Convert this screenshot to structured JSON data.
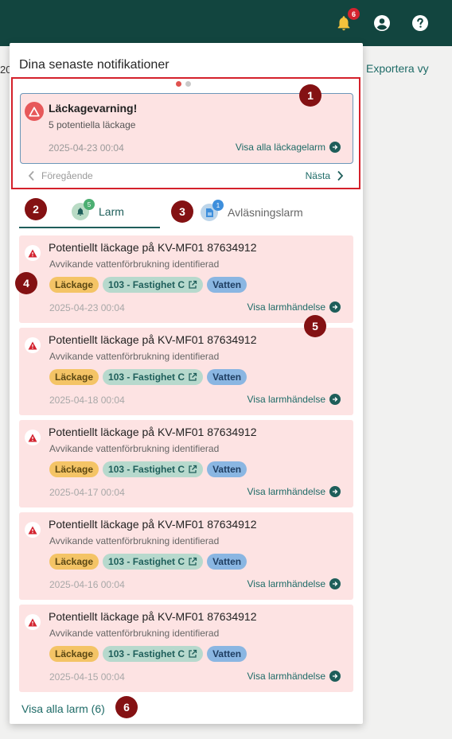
{
  "topbar": {
    "notification_count": "6",
    "bell_icon": "bell-icon",
    "user_icon": "user-circle-icon",
    "help_icon": "help-circle-icon",
    "bg_color": "#12453f"
  },
  "background": {
    "partial_number": "20",
    "export_label": "Exportera vy"
  },
  "panel": {
    "title": "Dina senaste notifikationer",
    "carousel": {
      "leak_title": "Läckagevarning!",
      "leak_sub": "5 potentiella läckage",
      "leak_date": "2025-04-23 00:04",
      "leak_link": "Visa alla läckagelarm",
      "prev_label": "Föregående",
      "next_label": "Nästa"
    },
    "tabs": [
      {
        "label": "Larm",
        "badge": "5",
        "icon": "bell-icon"
      },
      {
        "label": "Avläsningslarm",
        "badge": "1",
        "icon": "document-icon"
      }
    ],
    "alarms": [
      {
        "title": "Potentiellt läckage på KV-MF01 87634912",
        "sub": "Avvikande vattenförbrukning identifierad",
        "tags": [
          "Läckage",
          "103 - Fastighet C",
          "Vatten"
        ],
        "date": "2025-04-23 00:04",
        "link": "Visa larmhändelse"
      },
      {
        "title": "Potentiellt läckage på KV-MF01 87634912",
        "sub": "Avvikande vattenförbrukning identifierad",
        "tags": [
          "Läckage",
          "103 - Fastighet C",
          "Vatten"
        ],
        "date": "2025-04-18 00:04",
        "link": "Visa larmhändelse"
      },
      {
        "title": "Potentiellt läckage på KV-MF01 87634912",
        "sub": "Avvikande vattenförbrukning identifierad",
        "tags": [
          "Läckage",
          "103 - Fastighet C",
          "Vatten"
        ],
        "date": "2025-04-17 00:04",
        "link": "Visa larmhändelse"
      },
      {
        "title": "Potentiellt läckage på KV-MF01 87634912",
        "sub": "Avvikande vattenförbrukning identifierad",
        "tags": [
          "Läckage",
          "103 - Fastighet C",
          "Vatten"
        ],
        "date": "2025-04-16 00:04",
        "link": "Visa larmhändelse"
      },
      {
        "title": "Potentiellt läckage på KV-MF01 87634912",
        "sub": "Avvikande vattenförbrukning identifierad",
        "tags": [
          "Läckage",
          "103 - Fastighet C",
          "Vatten"
        ],
        "date": "2025-04-15 00:04",
        "link": "Visa larmhändelse"
      }
    ],
    "view_all": "Visa alla larm (6)"
  },
  "markers": [
    "1",
    "2",
    "3",
    "4",
    "5",
    "6"
  ],
  "colors": {
    "accent": "#1e6b67",
    "marker": "#841113",
    "alarm_bg": "#fde3e3",
    "tag_leak": "#f4c466",
    "tag_property": "#b7d9cd",
    "tag_water": "#8ab6e2"
  }
}
